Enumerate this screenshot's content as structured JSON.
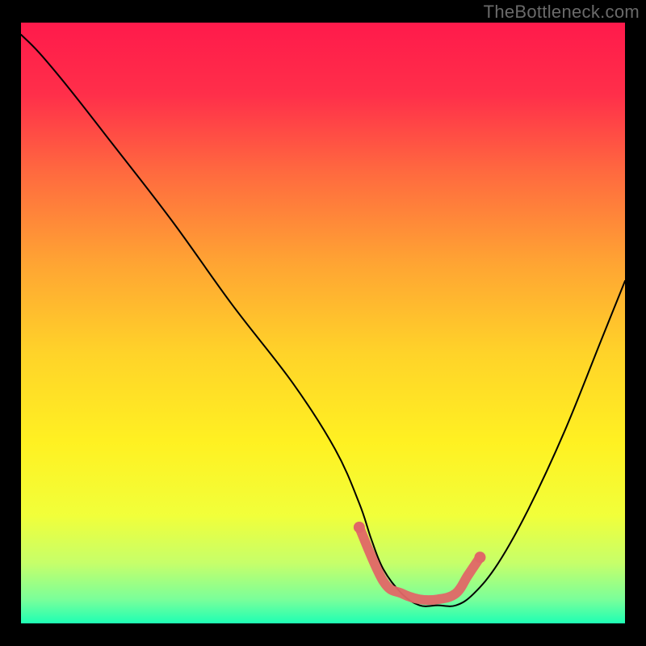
{
  "watermark": "TheBottleneck.com",
  "chart_data": {
    "type": "line",
    "title": "",
    "xlabel": "",
    "ylabel": "",
    "xlim": [
      0,
      100
    ],
    "ylim": [
      0,
      100
    ],
    "grid": false,
    "legend": false,
    "gradient_stops": [
      {
        "offset": 0.0,
        "color": "#ff1a4b"
      },
      {
        "offset": 0.12,
        "color": "#ff2f4a"
      },
      {
        "offset": 0.25,
        "color": "#ff6a3f"
      },
      {
        "offset": 0.4,
        "color": "#ffa433"
      },
      {
        "offset": 0.55,
        "color": "#ffd329"
      },
      {
        "offset": 0.7,
        "color": "#fff122"
      },
      {
        "offset": 0.82,
        "color": "#f1ff3a"
      },
      {
        "offset": 0.9,
        "color": "#c6ff6a"
      },
      {
        "offset": 0.96,
        "color": "#7aff9a"
      },
      {
        "offset": 1.0,
        "color": "#1effb4"
      }
    ],
    "series": [
      {
        "name": "bottleneck-curve",
        "color": "#000000",
        "x": [
          0,
          3,
          8,
          15,
          25,
          35,
          45,
          52,
          56,
          58,
          60,
          63,
          66,
          69,
          72,
          75,
          79,
          84,
          90,
          96,
          100
        ],
        "y": [
          98,
          95,
          89,
          80,
          67,
          53,
          40,
          29,
          20,
          14,
          9,
          5,
          3,
          3,
          3,
          5,
          10,
          19,
          32,
          47,
          57
        ]
      }
    ],
    "accent_markers": {
      "color": "#e06767",
      "points": [
        {
          "x": 56,
          "y": 16
        },
        {
          "x": 60,
          "y": 7
        },
        {
          "x": 63,
          "y": 5
        },
        {
          "x": 66,
          "y": 4
        },
        {
          "x": 69,
          "y": 4
        },
        {
          "x": 72,
          "y": 5
        },
        {
          "x": 74,
          "y": 8
        },
        {
          "x": 76,
          "y": 11
        }
      ]
    }
  }
}
